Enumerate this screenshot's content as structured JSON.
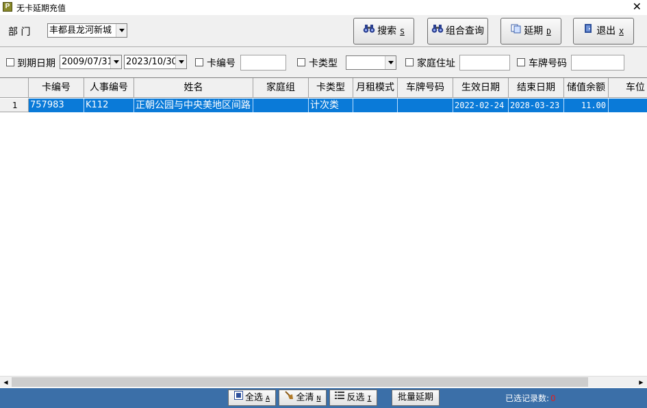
{
  "window": {
    "title": "无卡延期充值",
    "app_icon_letter": "P"
  },
  "filters": {
    "dept_label": "部  门",
    "dept_value": "丰都县龙河新城",
    "expire_label": "到期日期",
    "date_from": "2009/07/31",
    "date_to": "2023/10/30",
    "card_no_label": "卡编号",
    "card_no_value": "",
    "card_type_label": "卡类型",
    "card_type_value": "",
    "family_addr_label": "家庭住址",
    "family_addr_value": "",
    "plate_label": "车牌号码",
    "plate_value": ""
  },
  "toolbar": {
    "search": {
      "label": "搜索",
      "key": "S",
      "icon": "binoculars-icon"
    },
    "combo_query": {
      "label": "组合查询",
      "icon": "binoculars-icon"
    },
    "extend": {
      "label": "延期",
      "key": "D",
      "icon": "copy-icon"
    },
    "exit": {
      "label": "退出",
      "key": "X",
      "icon": "exit-door-icon"
    }
  },
  "table": {
    "columns": [
      "卡编号",
      "人事编号",
      "姓名",
      "家庭组",
      "卡类型",
      "月租模式",
      "车牌号码",
      "生效日期",
      "结束日期",
      "储值余额",
      "车位"
    ],
    "rows": [
      {
        "index": "1",
        "cells": [
          "757983",
          "K112",
          "正朝公园与中央美地区间路",
          "",
          "计次类",
          "",
          "",
          "2022-02-24",
          "2028-03-23",
          "11.00",
          ""
        ]
      }
    ]
  },
  "footer": {
    "select_all": {
      "label": "全选",
      "key": "A"
    },
    "clear_all": {
      "label": "全清",
      "key": "N"
    },
    "invert": {
      "label": "反选",
      "key": "I"
    },
    "batch_extend": {
      "label": "批量延期"
    },
    "selected_count_label": "已选记录数:",
    "selected_count": "0"
  },
  "colors": {
    "selection": "#0a7ad8",
    "footer_bg": "#3b6fa8",
    "count_red": "#e02020"
  }
}
